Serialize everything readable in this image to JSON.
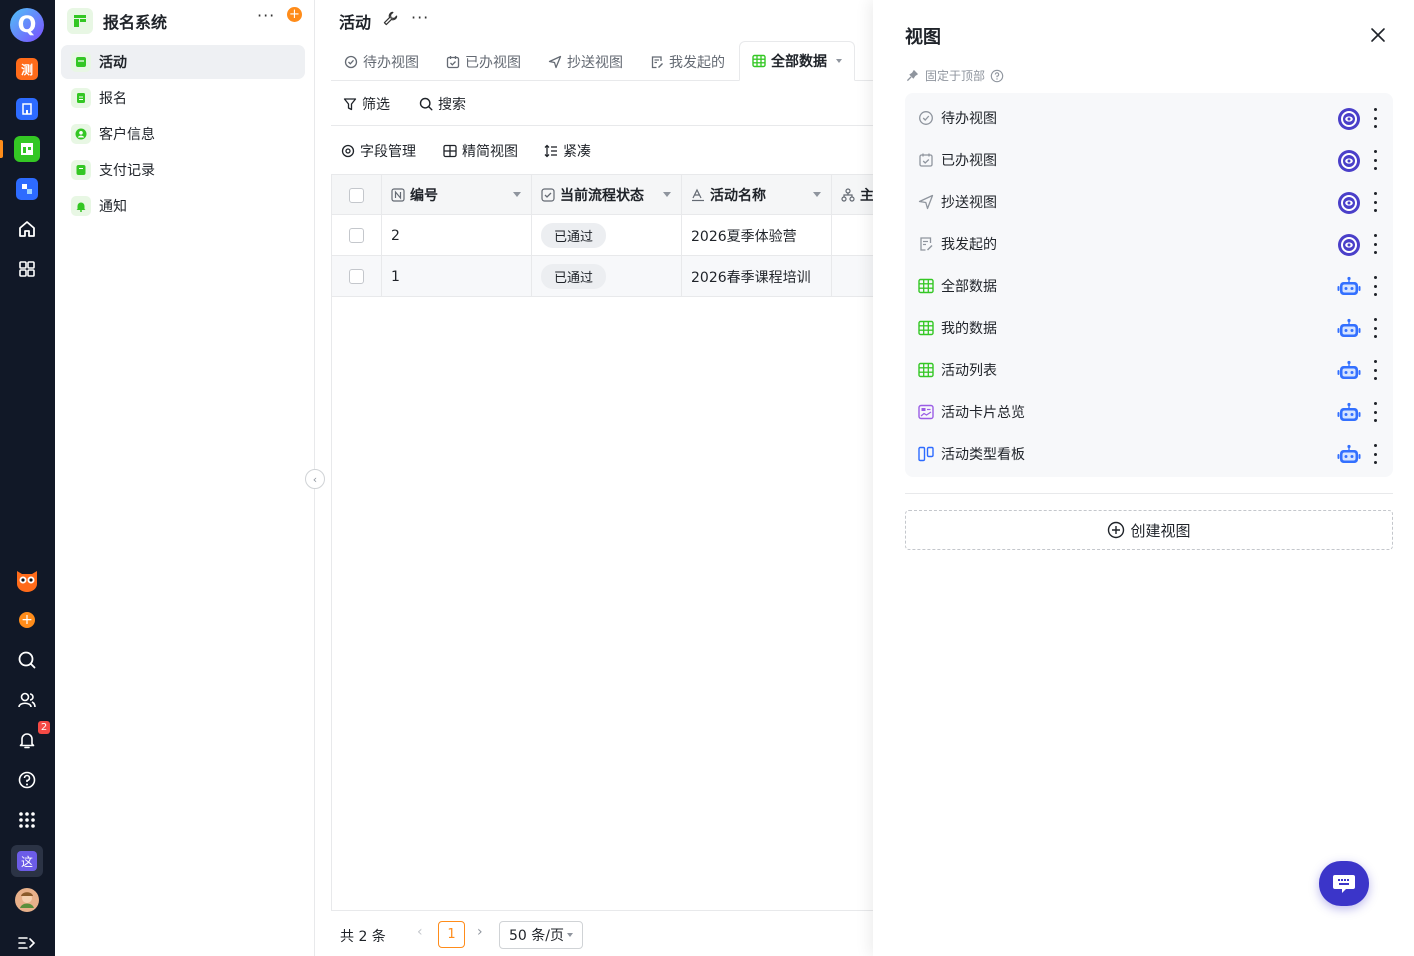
{
  "rail": {
    "logo": "Q",
    "items": [
      {
        "name": "测",
        "color": "#ff6b1a"
      },
      {
        "name": "app-blue-1",
        "color": "#2d6bff"
      },
      {
        "name": "app-green-active",
        "color": "#34c724"
      },
      {
        "name": "app-blue-2",
        "color": "#2d6bff"
      }
    ],
    "tool_icons": [
      "home-icon",
      "grid-apps-icon"
    ],
    "bottom_icons": [
      "owl-icon",
      "add-icon",
      "search-icon",
      "contacts-icon",
      "bell-icon",
      "help-icon",
      "apps-icon"
    ],
    "notification_count": "2",
    "workspace_label": "这",
    "expand_icon": "expand-icon"
  },
  "sidebar": {
    "title": "报名系统",
    "items": [
      {
        "label": "活动",
        "active": true,
        "icon": "table-icon"
      },
      {
        "label": "报名",
        "active": false,
        "icon": "clipboard-icon"
      },
      {
        "label": "客户信息",
        "active": false,
        "icon": "user-icon"
      },
      {
        "label": "支付记录",
        "active": false,
        "icon": "receipt-icon"
      },
      {
        "label": "通知",
        "active": false,
        "icon": "bell-icon"
      }
    ]
  },
  "main": {
    "title": "活动",
    "tabs": [
      {
        "label": "待办视图",
        "icon": "check-circle-icon"
      },
      {
        "label": "已办视图",
        "icon": "calendar-check-icon"
      },
      {
        "label": "抄送视图",
        "icon": "send-icon"
      },
      {
        "label": "我发起的",
        "icon": "doc-edit-icon"
      },
      {
        "label": "全部数据",
        "icon": "table-icon",
        "active": true
      }
    ],
    "toolbar1": {
      "filter": "筛选",
      "search": "搜索"
    },
    "toolbar2": {
      "fields": "字段管理",
      "simple": "精简视图",
      "compact": "紧凑"
    },
    "table": {
      "columns": [
        "编号",
        "当前流程状态",
        "活动名称",
        "主"
      ],
      "rows": [
        {
          "id": "2",
          "status": "已通过",
          "name": "2026夏季体验营"
        },
        {
          "id": "1",
          "status": "已通过",
          "name": "2026春季课程培训"
        }
      ]
    },
    "footer": {
      "total": "共 2 条",
      "page": "1",
      "page_size": "50 条/页"
    }
  },
  "panel": {
    "title": "视图",
    "pinned_label": "固定于顶部",
    "views": [
      {
        "label": "待办视图",
        "icon": "check-circle-icon",
        "status": "eye",
        "color": "#8f959e"
      },
      {
        "label": "已办视图",
        "icon": "calendar-check-icon",
        "status": "eye",
        "color": "#8f959e"
      },
      {
        "label": "抄送视图",
        "icon": "send-icon",
        "status": "eye",
        "color": "#8f959e"
      },
      {
        "label": "我发起的",
        "icon": "doc-edit-icon",
        "status": "eye",
        "color": "#8f959e"
      },
      {
        "label": "全部数据",
        "icon": "table-icon",
        "status": "robot",
        "color": "#34c724"
      },
      {
        "label": "我的数据",
        "icon": "table-icon",
        "status": "robot",
        "color": "#34c724"
      },
      {
        "label": "活动列表",
        "icon": "table-icon",
        "status": "robot",
        "color": "#34c724"
      },
      {
        "label": "活动卡片总览",
        "icon": "card-icon",
        "status": "robot",
        "color": "#9b5de5"
      },
      {
        "label": "活动类型看板",
        "icon": "kanban-icon",
        "status": "robot",
        "color": "#2d6bff"
      }
    ],
    "create_label": "创建视图"
  },
  "colors": {
    "accent": "#ff8c1a",
    "green": "#34c724",
    "purple": "#4a3fc9",
    "robot": "#3370ff"
  }
}
